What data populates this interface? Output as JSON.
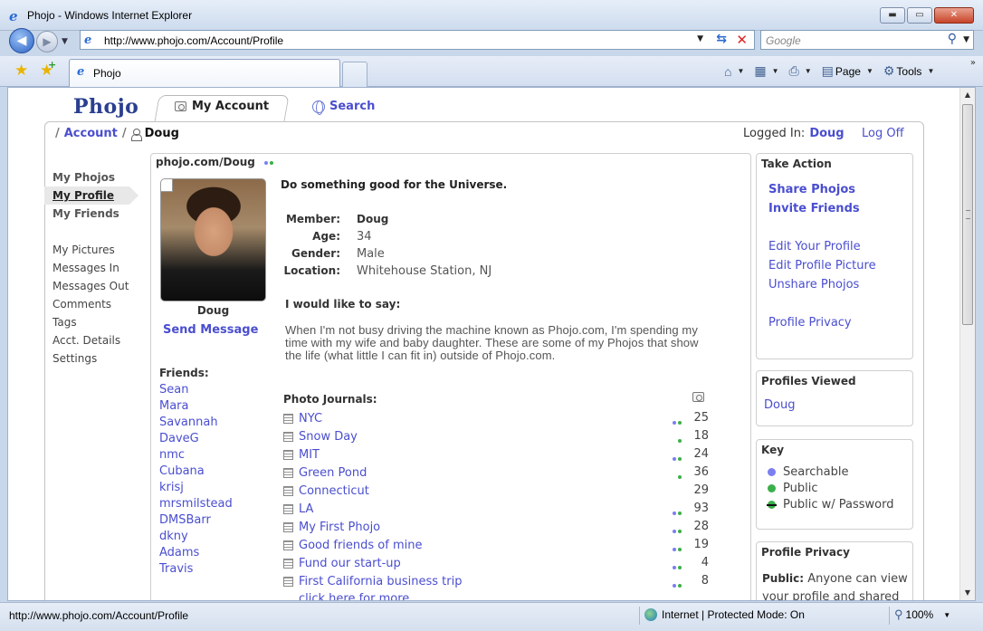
{
  "window": {
    "title": "Phojo - Windows Internet Explorer",
    "min_glyph": "▬",
    "max_glyph": "▭",
    "close_glyph": "✕"
  },
  "nav": {
    "url": "http://www.phojo.com/Account/Profile",
    "search_placeholder": "Google",
    "back_glyph": "◀",
    "forward_glyph": "▶"
  },
  "tabs": {
    "active_label": "Phojo"
  },
  "commands": {
    "page": "Page",
    "tools": "Tools",
    "overflow": "»"
  },
  "site": {
    "logo": "Phojo",
    "tab_my_account": "My Account",
    "tab_search": "Search"
  },
  "breadcrumb": {
    "account": "Account",
    "current": "Doug"
  },
  "session": {
    "logged_in_label": "Logged In:",
    "user": "Doug",
    "log_off": "Log Off"
  },
  "leftnav": {
    "primary": [
      "My Phojos",
      "My Profile",
      "My Friends"
    ],
    "secondary": [
      "My Pictures",
      "Messages In",
      "Messages Out",
      "Comments",
      "Tags",
      "Acct. Details",
      "Settings"
    ]
  },
  "profile": {
    "url": "phojo.com/Doug",
    "name": "Doug",
    "send_message": "Send Message",
    "tagline": "Do something good for the Universe.",
    "details": [
      {
        "k": "Member:",
        "v": "Doug"
      },
      {
        "k": "Age:",
        "v": "34"
      },
      {
        "k": "Gender:",
        "v": "Male"
      },
      {
        "k": "Location:",
        "v": "Whitehouse Station, NJ"
      }
    ],
    "say_title": "I would like to say:",
    "say_body": "When I'm not busy driving the machine known as Phojo.com, I'm spending my time with my wife and baby daughter. These are some of my Phojos that show the life (what little I can fit in) outside of Phojo.com.",
    "friends_title": "Friends:",
    "friends": [
      "Sean",
      "Mara",
      "Savannah",
      "DaveG",
      "nmc",
      "Cubana",
      "krisj",
      "mrsmilstead",
      "DMSBarr",
      "dkny",
      "Adams",
      "Travis"
    ]
  },
  "journals": {
    "title": "Photo Journals:",
    "items": [
      {
        "name": "NYC",
        "count": "25",
        "dots": [
          "blue",
          "green"
        ]
      },
      {
        "name": "Snow Day",
        "count": "18",
        "dots": [
          "green"
        ]
      },
      {
        "name": "MIT",
        "count": "24",
        "dots": [
          "blue",
          "green"
        ]
      },
      {
        "name": "Green Pond",
        "count": "36",
        "dots": [
          "green"
        ]
      },
      {
        "name": "Connecticut",
        "count": "29",
        "dots": []
      },
      {
        "name": "LA",
        "count": "93",
        "dots": [
          "blue",
          "green"
        ]
      },
      {
        "name": "My First Phojo",
        "count": "28",
        "dots": [
          "blue",
          "green"
        ]
      },
      {
        "name": "Good friends of mine",
        "count": "19",
        "dots": [
          "blue",
          "green"
        ]
      },
      {
        "name": "Fund our start-up",
        "count": "4",
        "dots": [
          "blue",
          "green"
        ]
      },
      {
        "name": "First California business trip",
        "count": "8",
        "dots": [
          "blue",
          "green"
        ]
      }
    ],
    "more": "click here for more..."
  },
  "take_action": {
    "title": "Take Action",
    "share": "Share Phojos",
    "invite": "Invite Friends",
    "edit_profile": "Edit Your Profile",
    "edit_picture": "Edit Profile Picture",
    "unshare": "Unshare Phojos",
    "privacy": "Profile Privacy"
  },
  "profiles_viewed": {
    "title": "Profiles Viewed",
    "item": "Doug"
  },
  "key": {
    "title": "Key",
    "searchable": "Searchable",
    "public": "Public",
    "public_pw": "Public w/ Password"
  },
  "profile_privacy": {
    "title": "Profile Privacy",
    "label": "Public:",
    "text": "Anyone can view your profile and shared"
  },
  "status": {
    "text": "http://www.phojo.com/Account/Profile",
    "zone": "Internet | Protected Mode: On",
    "zoom": "100%"
  },
  "colors": {
    "link": "#4a4ecf",
    "searchable_dot": "#7b7ff0",
    "public_dot": "#3ab04a"
  }
}
